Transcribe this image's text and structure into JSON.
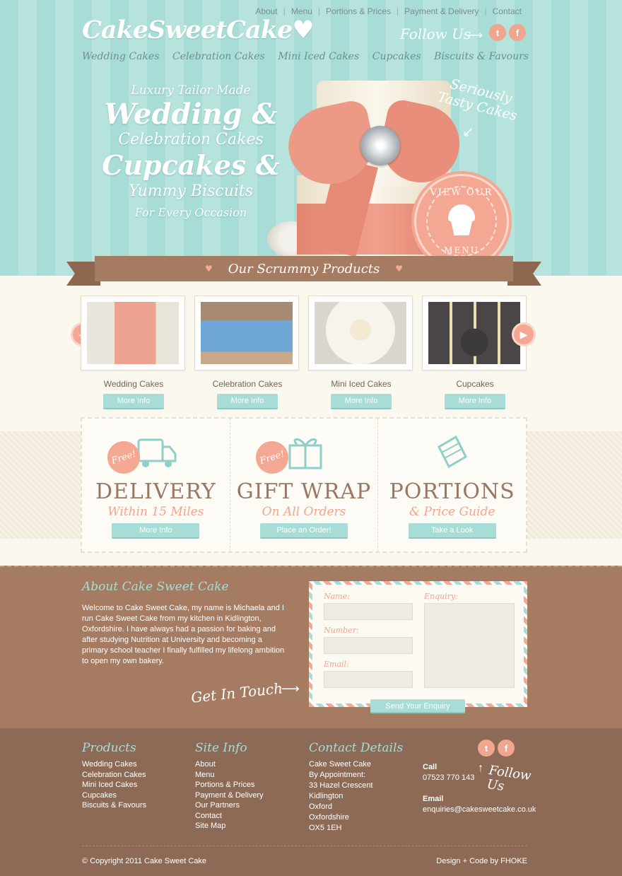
{
  "top_nav": [
    "About",
    "Menu",
    "Portions & Prices",
    "Payment & Delivery",
    "Contact"
  ],
  "logo": "CakeSweetCake♥",
  "follow_us": "Follow Us",
  "social": {
    "twitter": "t",
    "facebook": "f"
  },
  "category_nav": [
    "Wedding Cakes",
    "Celebration Cakes",
    "Mini Iced Cakes",
    "Cupcakes",
    "Biscuits & Favours"
  ],
  "hero": {
    "line1": "Luxury Tailor Made",
    "line2": "Wedding &",
    "line3": "Celebration Cakes",
    "line4": "Cupcakes &",
    "line5": "Yummy Biscuits",
    "line6": "For Every Occasion",
    "seriously": "Seriously Tasty Cakes",
    "badge_top": "VIEW OUR",
    "badge_bottom": "MENU"
  },
  "banner": "Our Scrummy Products",
  "products": [
    {
      "name": "Wedding Cakes",
      "button": "More Info"
    },
    {
      "name": "Celebration Cakes",
      "button": "More Info"
    },
    {
      "name": "Mini Iced Cakes",
      "button": "More Info"
    },
    {
      "name": "Cupcakes",
      "button": "More Info"
    }
  ],
  "features": [
    {
      "badge": "Free!",
      "title": "DELIVERY",
      "subtitle": "Within 15 Miles",
      "button": "More Info"
    },
    {
      "badge": "Free!",
      "title": "GIFT WRAP",
      "subtitle": "On All Orders",
      "button": "Place an Order!"
    },
    {
      "badge": "",
      "title": "PORTIONS",
      "subtitle": "& Price Guide",
      "button": "Take a Look"
    }
  ],
  "about": {
    "title": "About Cake Sweet Cake",
    "text": "Welcome to Cake Sweet Cake, my name is Michaela and I run Cake Sweet Cake from my kitchen in Kidlington, Oxfordshire. I have always had a passion for baking and after studying Nutrition at University and becoming a primary school teacher I finally fulfilled my lifelong ambition to open my own bakery.",
    "get_in_touch": "Get In Touch"
  },
  "form": {
    "name_label": "Name:",
    "number_label": "Number:",
    "email_label": "Email:",
    "enquiry_label": "Enquiry:",
    "submit": "Send Your Enquiry"
  },
  "footer": {
    "products_title": "Products",
    "products": [
      "Wedding Cakes",
      "Celebration Cakes",
      "Mini Iced Cakes",
      "Cupcakes",
      "Biscuits & Favours"
    ],
    "site_title": "Site Info",
    "site": [
      "About",
      "Menu",
      "Portions & Prices",
      "Payment & Delivery",
      "Our Partners",
      "Contact",
      "Site Map"
    ],
    "contact_title": "Contact Details",
    "address": [
      "Cake Sweet Cake",
      "By Appointment:",
      "33 Hazel Crescent",
      "Kidlington",
      "Oxford",
      "Oxfordshire",
      "OX5 1EH"
    ],
    "call_label": "Call",
    "phone": "07523 770 143",
    "email_label": "Email",
    "email": "enquiries@cakesweetcake.co.uk",
    "follow_us": "Follow Us",
    "copyright": "© Copyright 2011 Cake Sweet Cake",
    "credit": "Design + Code by FHOKE"
  },
  "colors": {
    "teal": "#a8dcd6",
    "coral": "#f4a792",
    "brown": "#a57c62",
    "dark_brown": "#8c6a55",
    "cream": "#fbf8f0"
  }
}
